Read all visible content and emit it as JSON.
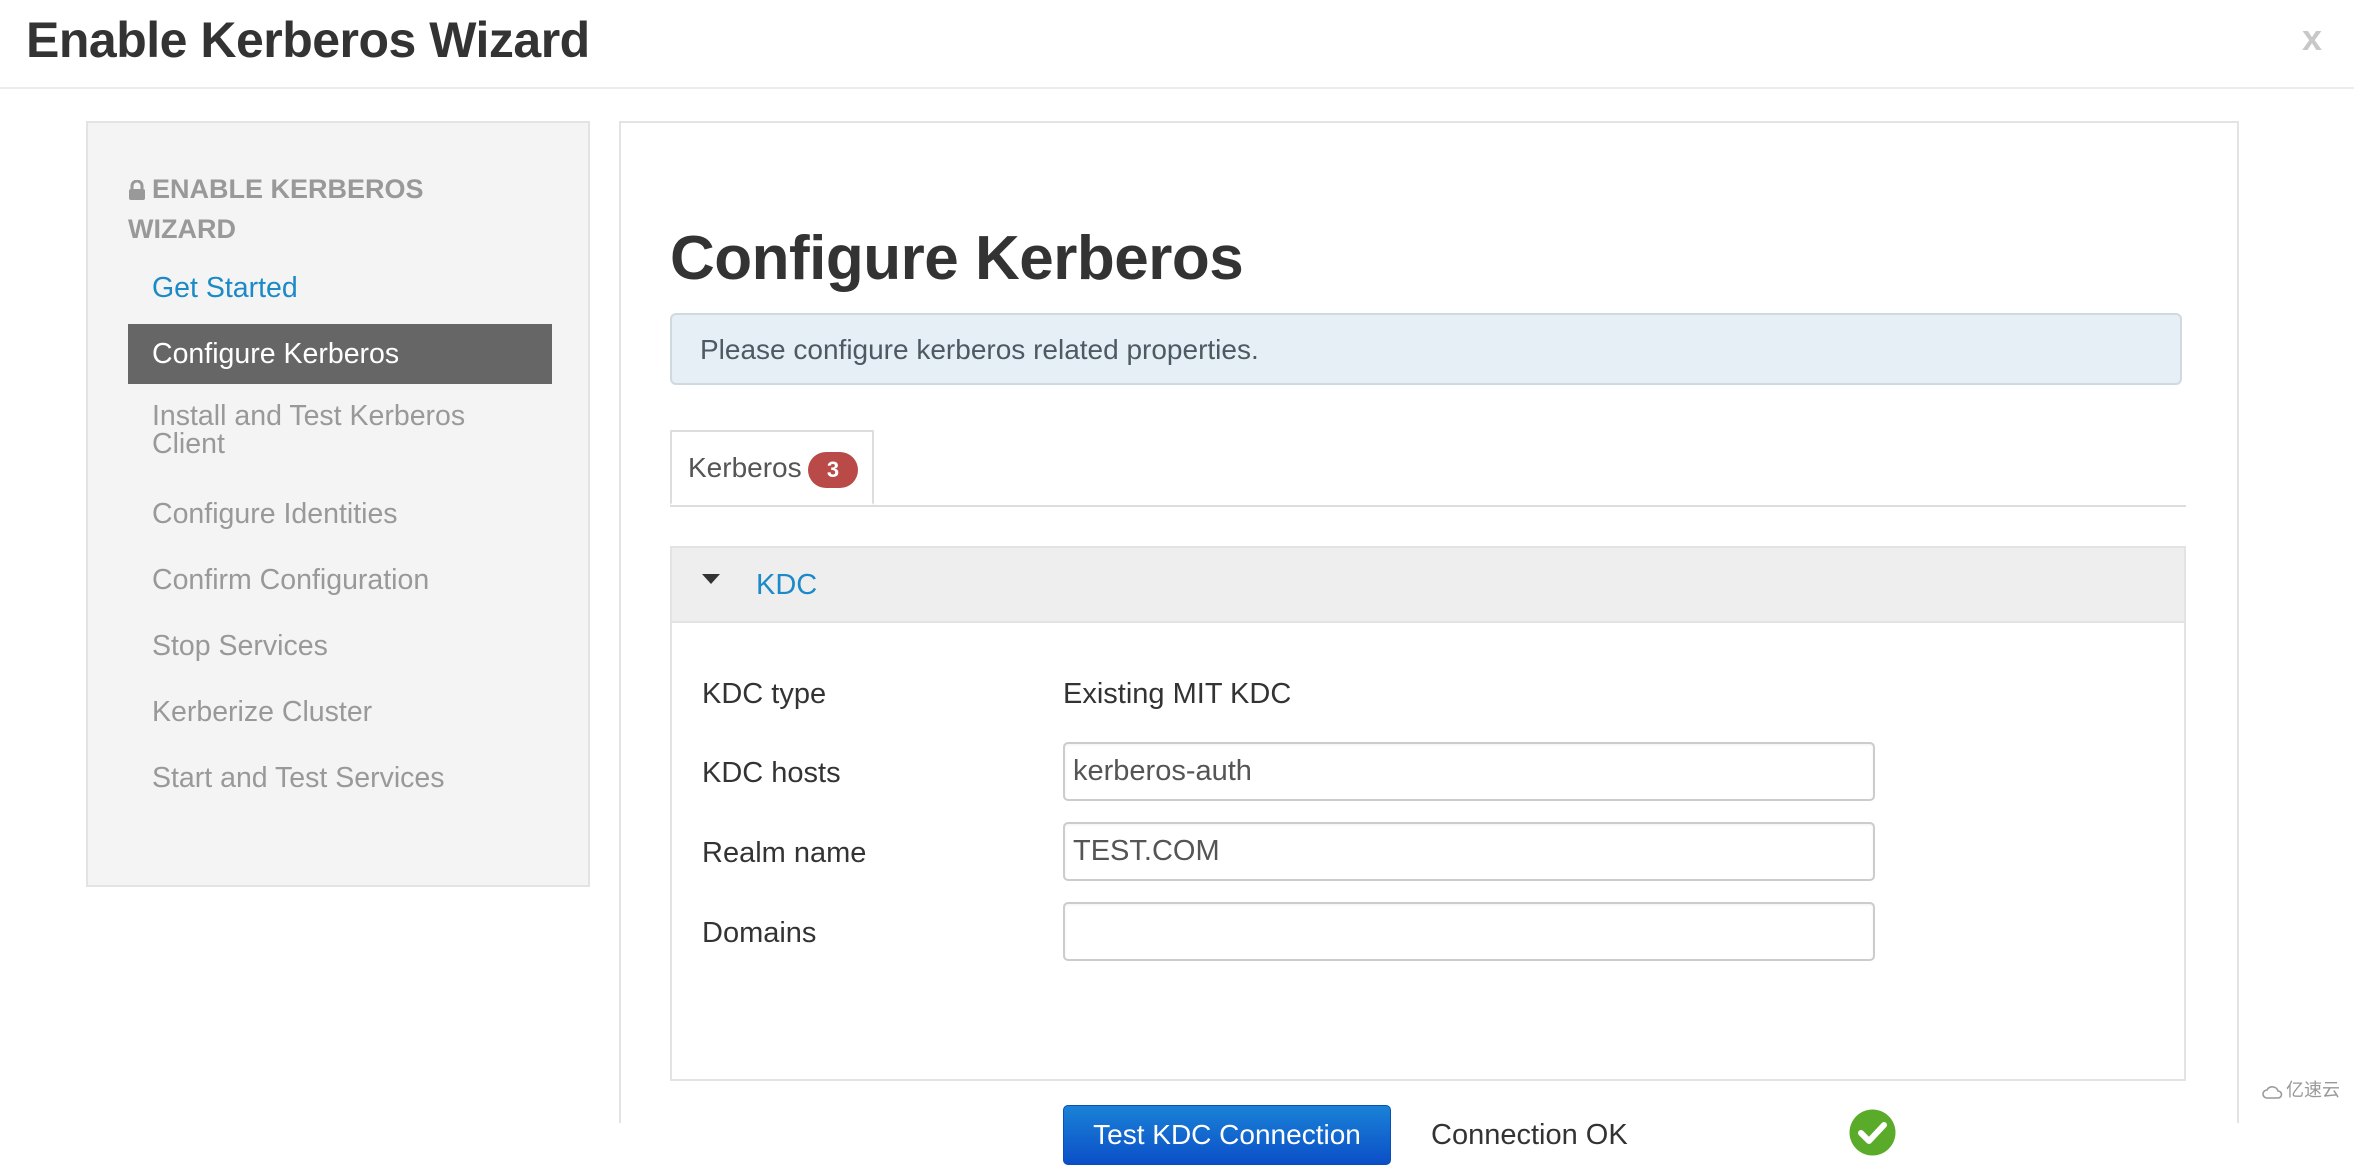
{
  "window": {
    "title": "Enable Kerberos Wizard",
    "close_label": "x"
  },
  "sidebar": {
    "heading": "ENABLE KERBEROS WIZARD",
    "heading_icon": "lock-icon",
    "items": [
      {
        "label": "Get Started",
        "state": "completed-link"
      },
      {
        "label": "Configure Kerberos",
        "state": "active"
      },
      {
        "label": "Install and Test Kerberos Client",
        "state": "disabled"
      },
      {
        "label": "Configure Identities",
        "state": "disabled"
      },
      {
        "label": "Confirm Configuration",
        "state": "disabled"
      },
      {
        "label": "Stop Services",
        "state": "disabled"
      },
      {
        "label": "Kerberize Cluster",
        "state": "disabled"
      },
      {
        "label": "Start and Test Services",
        "state": "disabled"
      }
    ]
  },
  "main": {
    "title": "Configure Kerberos",
    "info": "Please configure kerberos related properties.",
    "tabs": [
      {
        "label": "Kerberos",
        "badge": "3",
        "active": true
      }
    ],
    "section": {
      "title": "KDC",
      "expanded": true,
      "fields": {
        "kdc_type": {
          "label": "KDC type",
          "value": "Existing MIT KDC"
        },
        "kdc_hosts": {
          "label": "KDC hosts",
          "value": "kerberos-auth"
        },
        "realm_name": {
          "label": "Realm name",
          "value": "TEST.COM"
        },
        "domains": {
          "label": "Domains",
          "value": ""
        }
      },
      "test_button_label": "Test KDC Connection",
      "connection_status": "Connection OK",
      "status_icon": "check-circle-icon"
    }
  },
  "colors": {
    "link": "#1b8ac8",
    "active_step_bg": "#666666",
    "badge_bg": "#b94a48",
    "button_bg": "#0b5fd0",
    "success": "#5aab29",
    "info_bg": "#e5eff5"
  },
  "watermark": "亿速云"
}
